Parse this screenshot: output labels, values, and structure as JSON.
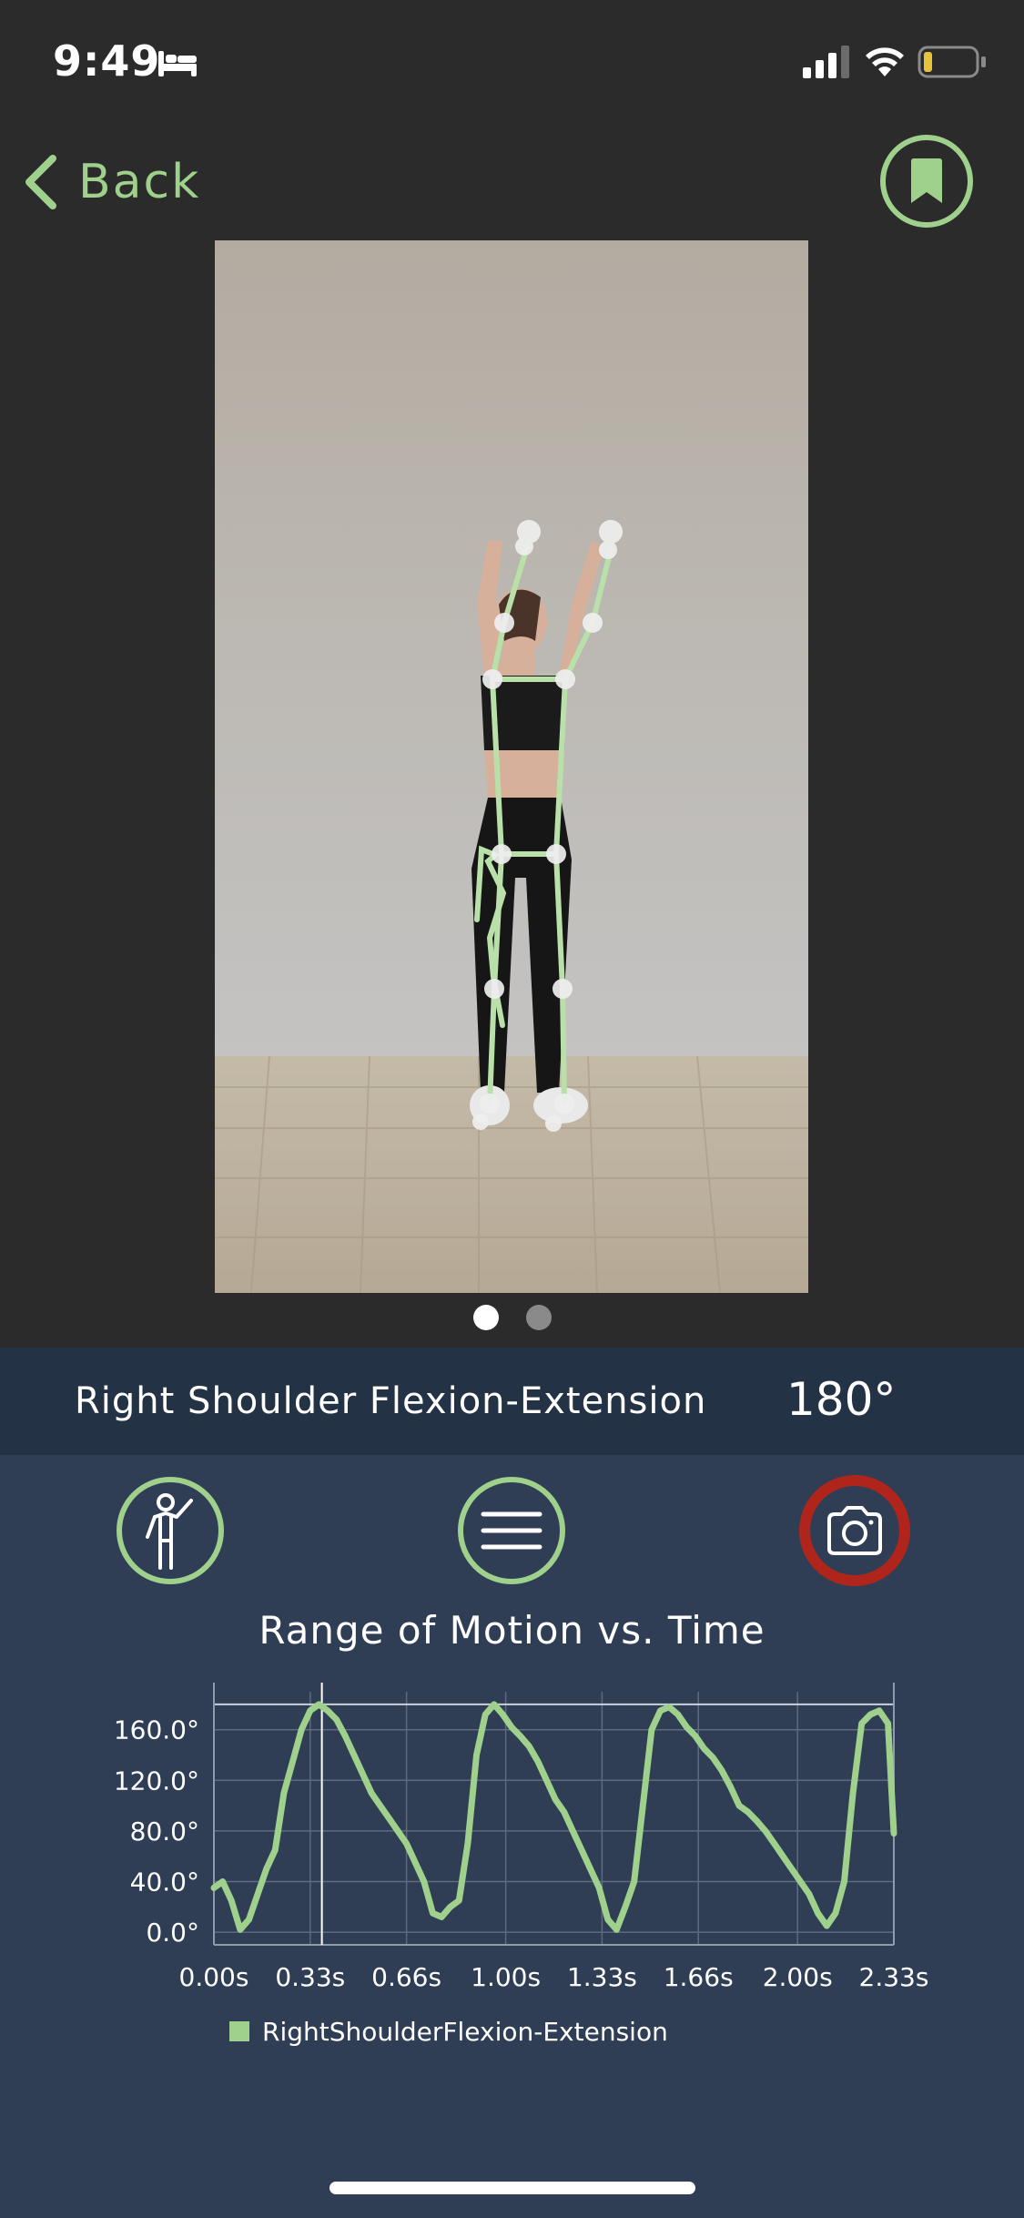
{
  "status_bar": {
    "time": "9:49",
    "icons": [
      "bed-icon",
      "signal-icon",
      "wifi-icon",
      "battery-icon"
    ],
    "battery_color": "#e8c23a"
  },
  "nav": {
    "back_label": "Back",
    "bookmark_icon": "bookmark-icon"
  },
  "video": {
    "skeleton_color": "#b8e0a8",
    "pager": {
      "count": 2,
      "active_index": 0
    }
  },
  "metric": {
    "name": "Right Shoulder Flexion-Extension",
    "value": "180°"
  },
  "actions": [
    {
      "name": "pose-button",
      "icon": "pose-figure-icon"
    },
    {
      "name": "menu-button",
      "icon": "hamburger-menu-icon"
    },
    {
      "name": "camera-button",
      "icon": "camera-icon",
      "accent": "#b0251b"
    }
  ],
  "colors": {
    "accent_green": "#9fd08c",
    "background": "#2b2b2b",
    "panel": "#2f3e55",
    "metric_band": "#243246",
    "record_red": "#b0251b"
  },
  "chart_title": "Range of Motion vs. Time",
  "chart_data": {
    "type": "line",
    "title": "Range of Motion vs. Time",
    "xlabel": "",
    "ylabel": "",
    "x_ticks": [
      "0.00s",
      "0.33s",
      "0.66s",
      "1.00s",
      "1.33s",
      "1.66s",
      "2.00s",
      "2.33s"
    ],
    "y_ticks": [
      "0.0°",
      "40.0°",
      "80.0°",
      "120.0°",
      "160.0°"
    ],
    "xlim": [
      0,
      2.33
    ],
    "ylim": [
      -10,
      190
    ],
    "grid": true,
    "legend_position": "bottom-left",
    "cursor_x": 0.37,
    "series": [
      {
        "name": "RightShoulderFlexion-Extension",
        "color": "#9fd08c",
        "x": [
          0.0,
          0.03,
          0.06,
          0.09,
          0.12,
          0.15,
          0.18,
          0.21,
          0.24,
          0.27,
          0.3,
          0.33,
          0.36,
          0.39,
          0.42,
          0.45,
          0.48,
          0.51,
          0.54,
          0.57,
          0.6,
          0.63,
          0.66,
          0.69,
          0.72,
          0.75,
          0.78,
          0.81,
          0.84,
          0.87,
          0.9,
          0.93,
          0.96,
          0.99,
          1.02,
          1.05,
          1.08,
          1.11,
          1.14,
          1.17,
          1.2,
          1.23,
          1.26,
          1.29,
          1.32,
          1.35,
          1.38,
          1.41,
          1.44,
          1.47,
          1.5,
          1.53,
          1.56,
          1.59,
          1.62,
          1.65,
          1.68,
          1.71,
          1.74,
          1.77,
          1.8,
          1.83,
          1.86,
          1.89,
          1.92,
          1.95,
          1.98,
          2.01,
          2.04,
          2.07,
          2.1,
          2.13,
          2.16,
          2.19,
          2.22,
          2.25,
          2.28,
          2.31,
          2.33
        ],
        "y": [
          35,
          40,
          25,
          2,
          10,
          30,
          50,
          65,
          110,
          135,
          160,
          175,
          180,
          175,
          168,
          155,
          140,
          125,
          110,
          100,
          90,
          80,
          70,
          55,
          40,
          15,
          12,
          20,
          25,
          70,
          140,
          172,
          180,
          172,
          162,
          155,
          147,
          135,
          120,
          105,
          95,
          80,
          65,
          50,
          35,
          10,
          2,
          20,
          40,
          100,
          160,
          175,
          178,
          172,
          162,
          155,
          145,
          138,
          128,
          115,
          100,
          95,
          88,
          80,
          70,
          60,
          50,
          40,
          30,
          15,
          5,
          15,
          40,
          110,
          165,
          172,
          175,
          165,
          78
        ]
      }
    ]
  }
}
